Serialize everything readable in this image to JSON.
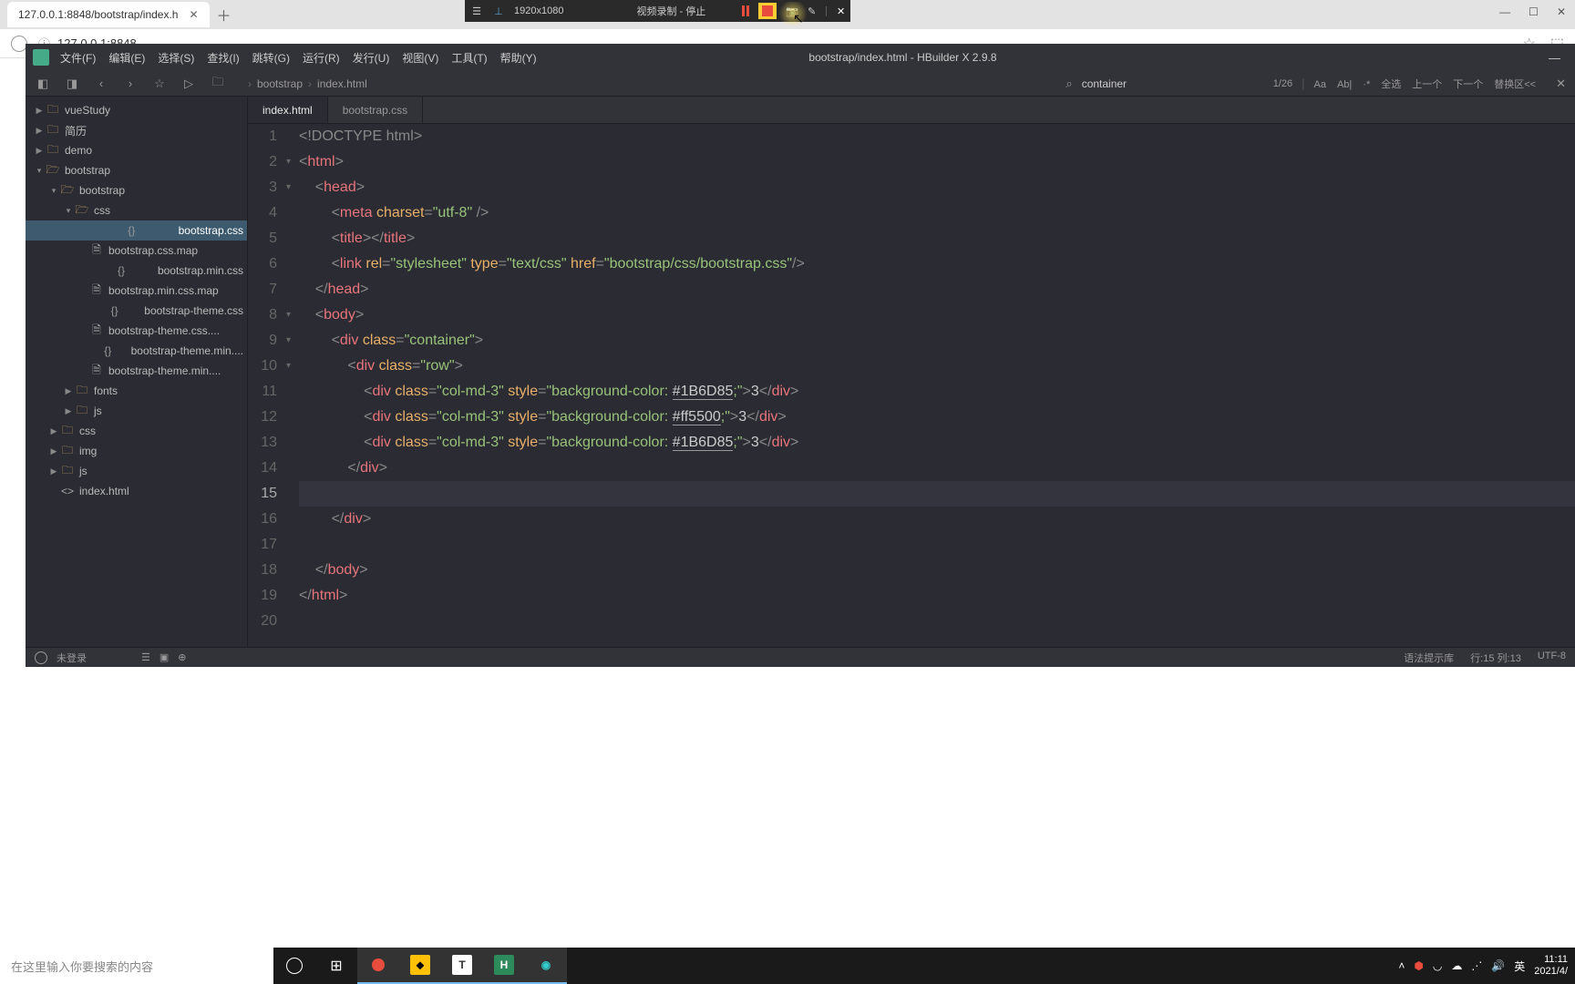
{
  "browser": {
    "tab_title": "127.0.0.1:8848/bootstrap/index.h",
    "address": "127.0.0.1:8848"
  },
  "recorder": {
    "resolution": "1920x1080",
    "status": "视频录制 - 停止"
  },
  "ide": {
    "title": "bootstrap/index.html - HBuilder X 2.9.8",
    "menus": [
      "文件(F)",
      "编辑(E)",
      "选择(S)",
      "查找(I)",
      "跳转(G)",
      "运行(R)",
      "发行(U)",
      "视图(V)",
      "工具(T)",
      "帮助(Y)"
    ],
    "breadcrumbs": [
      "bootstrap",
      "index.html"
    ],
    "find": {
      "value": "container",
      "count": "1/26",
      "opts": [
        "Aa",
        "Ab|",
        "·*",
        "全选",
        "上一个",
        "下一个",
        "替换区<<"
      ]
    },
    "tabs": [
      {
        "label": "index.html",
        "active": true
      },
      {
        "label": "bootstrap.css",
        "active": false
      }
    ],
    "tree": [
      {
        "indent": 0,
        "chev": "▶",
        "icon": "folder",
        "label": "vueStudy"
      },
      {
        "indent": 0,
        "chev": "▶",
        "icon": "folder",
        "label": "简历"
      },
      {
        "indent": 0,
        "chev": "▶",
        "icon": "folder",
        "label": "demo"
      },
      {
        "indent": 0,
        "chev": "▾",
        "icon": "folder-open",
        "label": "bootstrap"
      },
      {
        "indent": 1,
        "chev": "▾",
        "icon": "folder-open",
        "label": "bootstrap"
      },
      {
        "indent": 2,
        "chev": "▾",
        "icon": "folder-open",
        "label": "css"
      },
      {
        "indent": 3,
        "chev": "",
        "icon": "code",
        "label": "bootstrap.css",
        "selected": true
      },
      {
        "indent": 3,
        "chev": "",
        "icon": "file",
        "label": "bootstrap.css.map"
      },
      {
        "indent": 3,
        "chev": "",
        "icon": "code",
        "label": "bootstrap.min.css"
      },
      {
        "indent": 3,
        "chev": "",
        "icon": "file",
        "label": "bootstrap.min.css.map"
      },
      {
        "indent": 3,
        "chev": "",
        "icon": "code",
        "label": "bootstrap-theme.css"
      },
      {
        "indent": 3,
        "chev": "",
        "icon": "file",
        "label": "bootstrap-theme.css...."
      },
      {
        "indent": 3,
        "chev": "",
        "icon": "code",
        "label": "bootstrap-theme.min...."
      },
      {
        "indent": 3,
        "chev": "",
        "icon": "file",
        "label": "bootstrap-theme.min...."
      },
      {
        "indent": 2,
        "chev": "▶",
        "icon": "folder",
        "label": "fonts"
      },
      {
        "indent": 2,
        "chev": "▶",
        "icon": "folder",
        "label": "js"
      },
      {
        "indent": 1,
        "chev": "▶",
        "icon": "folder",
        "label": "css"
      },
      {
        "indent": 1,
        "chev": "▶",
        "icon": "folder",
        "label": "img"
      },
      {
        "indent": 1,
        "chev": "▶",
        "icon": "folder",
        "label": "js"
      },
      {
        "indent": 1,
        "chev": "",
        "icon": "html",
        "label": "index.html"
      }
    ],
    "code": {
      "lines": 20,
      "current_line": 15,
      "content": [
        {
          "n": 1,
          "html": "<span class='t-bracket'>&lt;!</span><span class='t-doctype'>DOCTYPE html</span><span class='t-bracket'>&gt;</span>"
        },
        {
          "n": 2,
          "html": "<span class='t-bracket'>&lt;</span><span class='t-tag'>html</span><span class='t-bracket'>&gt;</span>"
        },
        {
          "n": 3,
          "html": "    <span class='t-bracket'>&lt;</span><span class='t-tag'>head</span><span class='t-bracket'>&gt;</span>"
        },
        {
          "n": 4,
          "html": "        <span class='t-bracket'>&lt;</span><span class='t-tag'>meta</span> <span class='t-attr'>charset</span><span class='t-bracket'>=</span><span class='t-str'>\"utf-8\"</span> <span class='t-bracket'>/&gt;</span>"
        },
        {
          "n": 5,
          "html": "        <span class='t-bracket'>&lt;</span><span class='t-tag'>title</span><span class='t-bracket'>&gt;&lt;/</span><span class='t-tag'>title</span><span class='t-bracket'>&gt;</span>"
        },
        {
          "n": 6,
          "html": "        <span class='t-bracket'>&lt;</span><span class='t-tag'>link</span> <span class='t-attr'>rel</span><span class='t-bracket'>=</span><span class='t-str'>\"stylesheet\"</span> <span class='t-attr'>type</span><span class='t-bracket'>=</span><span class='t-str'>\"text/css\"</span> <span class='t-attr'>href</span><span class='t-bracket'>=</span><span class='t-str'>\"bootstrap/css/bootstrap.css\"</span><span class='t-bracket'>/&gt;</span>"
        },
        {
          "n": 7,
          "html": "    <span class='t-bracket'>&lt;/</span><span class='t-tag'>head</span><span class='t-bracket'>&gt;</span>"
        },
        {
          "n": 8,
          "html": "    <span class='t-bracket'>&lt;</span><span class='t-tag'>body</span><span class='t-bracket'>&gt;</span>"
        },
        {
          "n": 9,
          "html": "        <span class='t-bracket'>&lt;</span><span class='t-tag'>div</span> <span class='t-attr'>class</span><span class='t-bracket'>=</span><span class='t-str'>\"container\"</span><span class='t-bracket'>&gt;</span>"
        },
        {
          "n": 10,
          "html": "            <span class='t-bracket'>&lt;</span><span class='t-tag'>div</span> <span class='t-attr'>class</span><span class='t-bracket'>=</span><span class='t-str'>\"row\"</span><span class='t-bracket'>&gt;</span>"
        },
        {
          "n": 11,
          "html": "                <span class='t-bracket'>&lt;</span><span class='t-tag'>div</span> <span class='t-attr'>class</span><span class='t-bracket'>=</span><span class='t-str'>\"col-md-3\"</span> <span class='t-attr'>style</span><span class='t-bracket'>=</span><span class='t-str'>\"background-color: </span><span class='t-color'>#1B6D85</span><span class='t-str'>;\"</span><span class='t-bracket'>&gt;</span>3<span class='t-bracket'>&lt;/</span><span class='t-tag'>div</span><span class='t-bracket'>&gt;</span>"
        },
        {
          "n": 12,
          "html": "                <span class='t-bracket'>&lt;</span><span class='t-tag'>div</span> <span class='t-attr'>class</span><span class='t-bracket'>=</span><span class='t-str'>\"col-md-3\"</span> <span class='t-attr'>style</span><span class='t-bracket'>=</span><span class='t-str'>\"background-color: </span><span class='t-color'>#ff5500</span><span class='t-str'>;\"</span><span class='t-bracket'>&gt;</span>3<span class='t-bracket'>&lt;/</span><span class='t-tag'>div</span><span class='t-bracket'>&gt;</span>"
        },
        {
          "n": 13,
          "html": "                <span class='t-bracket'>&lt;</span><span class='t-tag'>div</span> <span class='t-attr'>class</span><span class='t-bracket'>=</span><span class='t-str'>\"col-md-3\"</span> <span class='t-attr'>style</span><span class='t-bracket'>=</span><span class='t-str'>\"background-color: </span><span class='t-color'>#1B6D85</span><span class='t-str'>;\"</span><span class='t-bracket'>&gt;</span>3<span class='t-bracket'>&lt;/</span><span class='t-tag'>div</span><span class='t-bracket'>&gt;</span>"
        },
        {
          "n": 14,
          "html": "            <span class='t-bracket'>&lt;/</span><span class='t-tag'>div</span><span class='t-bracket'>&gt;</span>"
        },
        {
          "n": 15,
          "html": ""
        },
        {
          "n": 16,
          "html": "        <span class='t-bracket'>&lt;/</span><span class='t-tag'>div</span><span class='t-bracket'>&gt;</span>"
        },
        {
          "n": 17,
          "html": ""
        },
        {
          "n": 18,
          "html": "    <span class='t-bracket'>&lt;/</span><span class='t-tag'>body</span><span class='t-bracket'>&gt;</span>"
        },
        {
          "n": 19,
          "html": "<span class='t-bracket'>&lt;/</span><span class='t-tag'>html</span><span class='t-bracket'>&gt;</span>"
        },
        {
          "n": 20,
          "html": ""
        }
      ]
    },
    "status": {
      "login": "未登录",
      "syntax": "语法提示库",
      "pos": "行:15  列:13",
      "encoding": "UTF-8"
    }
  },
  "taskbar": {
    "search_placeholder": "在这里输入你要搜索的内容",
    "time": "11:11",
    "date": "2021/4/",
    "ime": "英"
  },
  "windows_btns": {
    "minimize": "—",
    "maximize": "☐",
    "close": "✕"
  }
}
